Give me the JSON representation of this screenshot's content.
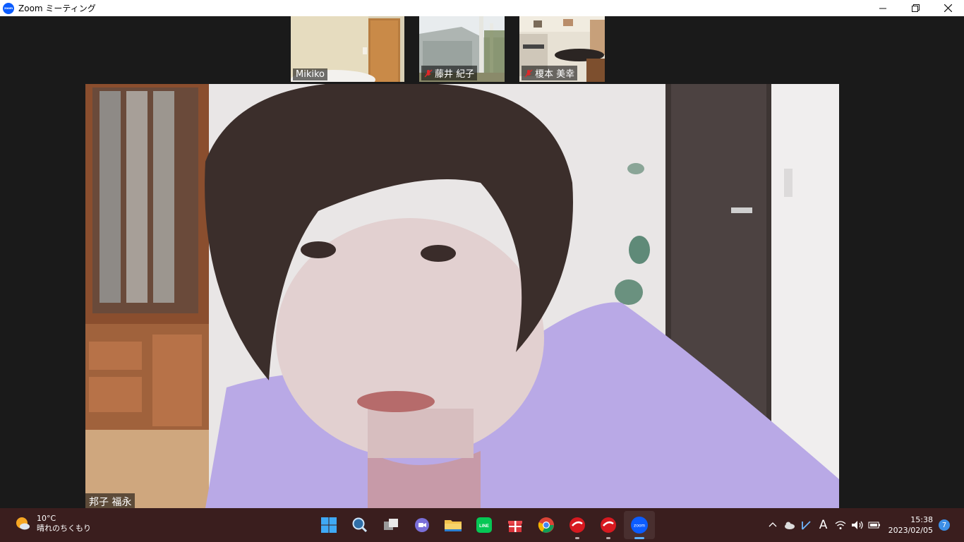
{
  "window": {
    "title": "Zoom ミーティング",
    "controls": [
      "minimize",
      "restore",
      "close"
    ]
  },
  "meeting": {
    "thumbnails": [
      {
        "name": "Mikiko",
        "muted": false
      },
      {
        "name": "藤井 紀子",
        "muted": true
      },
      {
        "name": "榎本 美幸",
        "muted": true
      }
    ],
    "active_speaker": {
      "name": "邦子 福永"
    }
  },
  "taskbar": {
    "weather": {
      "temp": "10°C",
      "desc": "晴れのちくもり",
      "icon": "partly-cloudy-icon"
    },
    "apps": [
      {
        "name": "start-button",
        "icon": "windows-logo-icon"
      },
      {
        "name": "search-button",
        "icon": "search-icon"
      },
      {
        "name": "task-view-button",
        "icon": "task-view-icon"
      },
      {
        "name": "teams-chat-button",
        "icon": "video-chat-icon"
      },
      {
        "name": "file-explorer-button",
        "icon": "folder-icon"
      },
      {
        "name": "line-app-button",
        "icon": "line-icon",
        "label": "LINE"
      },
      {
        "name": "gift-app-button",
        "icon": "gift-icon"
      },
      {
        "name": "chrome-button",
        "icon": "chrome-icon"
      },
      {
        "name": "trend-micro-button-1",
        "icon": "trend-micro-icon"
      },
      {
        "name": "trend-micro-button-2",
        "icon": "trend-micro-icon"
      },
      {
        "name": "zoom-app-button",
        "icon": "zoom-icon",
        "label": "zoom"
      }
    ],
    "clock": {
      "time": "15:38",
      "date": "2023/02/05"
    },
    "notifications": "7",
    "ime": "A",
    "colors": {
      "taskbar_bg": "#3a1e1e",
      "zoom_blue": "#0b5cff",
      "accent": "#5fb1ff"
    }
  }
}
